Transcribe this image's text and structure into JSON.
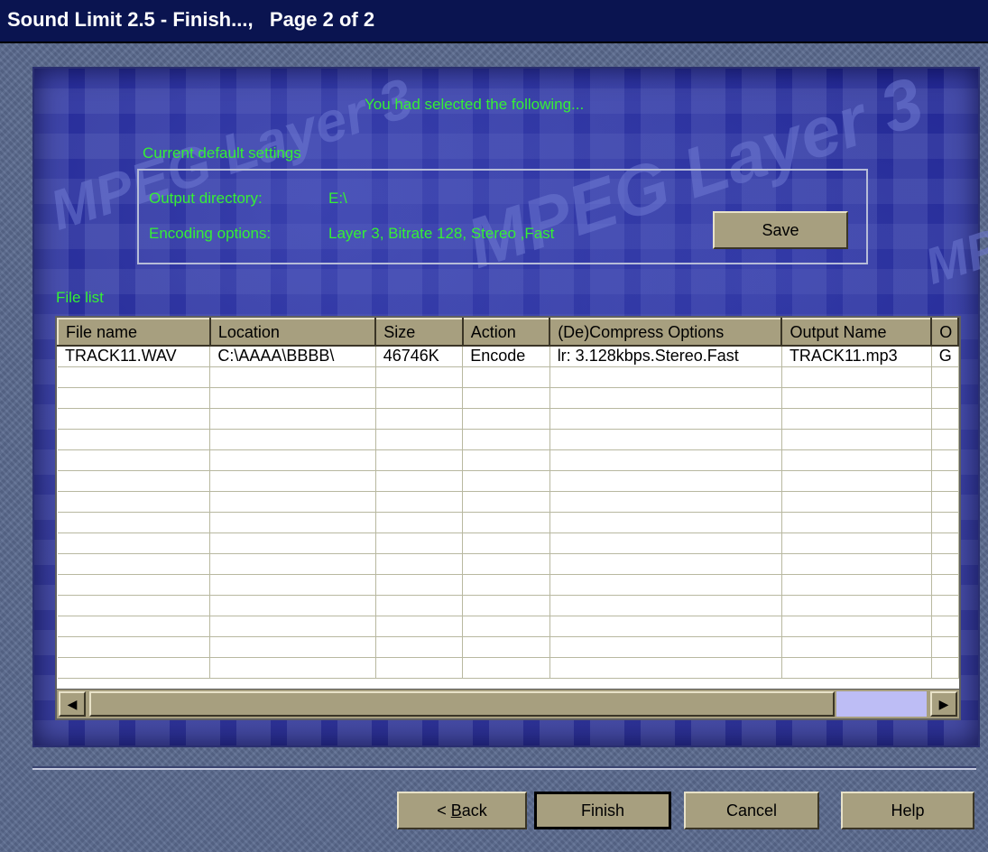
{
  "window": {
    "title": "Sound Limit 2.5 - Finish...,   Page 2 of 2"
  },
  "art": {
    "watermark": "MPEG Layer 3"
  },
  "summary": {
    "heading": "You had selected the following...",
    "defaults_label": "Current default settings",
    "output_directory_label": "Output directory:",
    "output_directory_value": "E:\\",
    "encoding_options_label": "Encoding options:",
    "encoding_options_value": "Layer 3, Bitrate 128, Stereo ,Fast",
    "save_label": "Save"
  },
  "file_list": {
    "label": "File list",
    "columns": [
      "File name",
      "Location",
      "Size",
      "Action",
      "(De)Compress Options",
      "Output Name",
      "O"
    ],
    "rows": [
      [
        "TRACK11.WAV",
        "C:\\AAAA\\BBBB\\",
        "46746K",
        "Encode",
        "lr: 3.128kbps.Stereo.Fast",
        "TRACK11.mp3",
        "G"
      ]
    ],
    "empty_rows": 15
  },
  "scrollbar": {
    "left_arrow": "◀",
    "right_arrow": "▶"
  },
  "buttons": {
    "back_prefix": "< ",
    "back_mnemonic": "B",
    "back_rest": "ack",
    "finish": "Finish",
    "cancel": "Cancel",
    "help": "Help"
  }
}
